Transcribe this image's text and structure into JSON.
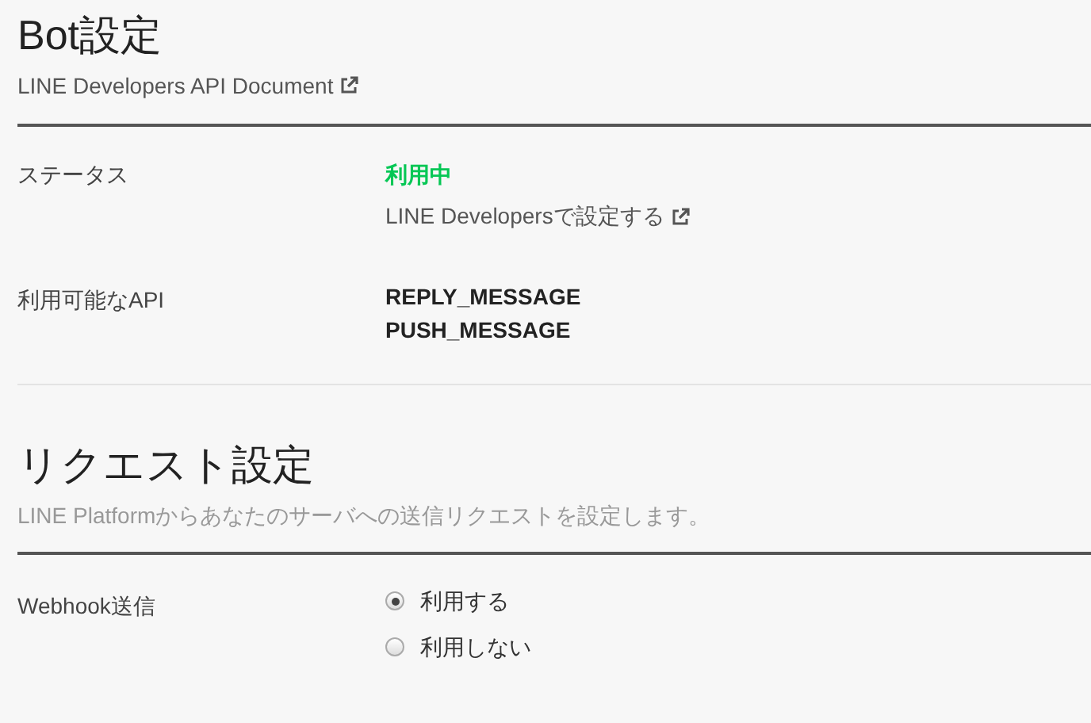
{
  "sections": [
    {
      "title": "Bot設定",
      "link": "LINE Developers API Document",
      "rows": [
        {
          "label": "ステータス",
          "kind": "status",
          "status": "利用中",
          "link": "LINE Developersで設定する"
        },
        {
          "label": "利用可能なAPI",
          "kind": "list",
          "items": [
            "REPLY_MESSAGE",
            "PUSH_MESSAGE"
          ]
        }
      ]
    },
    {
      "title": "リクエスト設定",
      "description": "LINE Platformからあなたのサーバへの送信リクエストを設定します。",
      "rows": [
        {
          "label": "Webhook送信",
          "kind": "radio",
          "options": [
            {
              "label": "利用する",
              "selected": true
            },
            {
              "label": "利用しない",
              "selected": false
            }
          ]
        }
      ]
    }
  ]
}
